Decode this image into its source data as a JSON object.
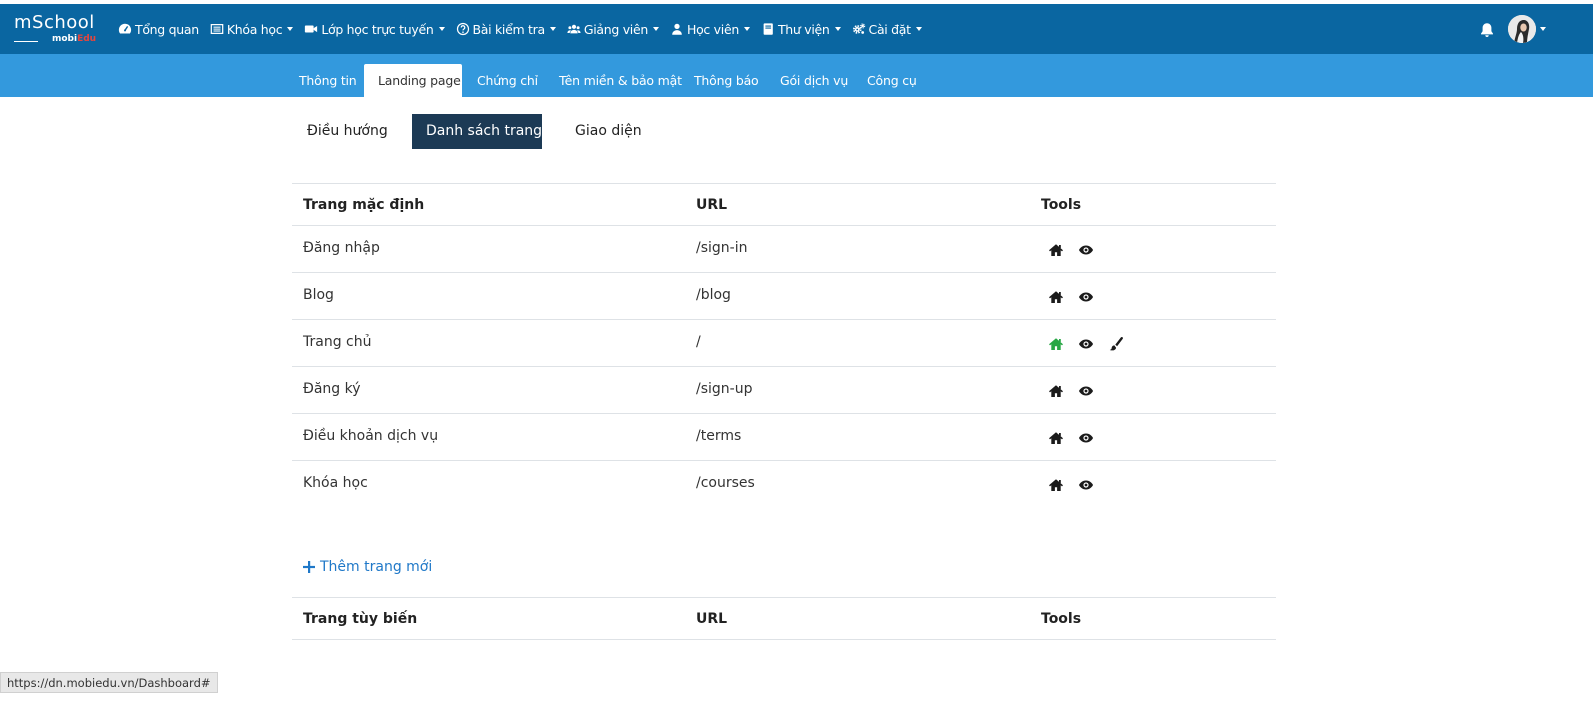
{
  "brand": {
    "logo_main": "mSchool",
    "logo_sub_a": "mobi",
    "logo_sub_b": "Edu"
  },
  "nav": [
    {
      "label": "Tổng quan",
      "icon": "dashboard-icon",
      "dropdown": false
    },
    {
      "label": "Khóa học",
      "icon": "list-icon",
      "dropdown": true
    },
    {
      "label": "Lớp học trực tuyến",
      "icon": "video-camera-icon",
      "dropdown": true
    },
    {
      "label": "Bài kiểm tra",
      "icon": "question-circle-icon",
      "dropdown": true
    },
    {
      "label": "Giảng viên",
      "icon": "users-icon",
      "dropdown": true
    },
    {
      "label": "Học viên",
      "icon": "user-icon",
      "dropdown": true
    },
    {
      "label": "Thư viện",
      "icon": "book-icon",
      "dropdown": true
    },
    {
      "label": "Cài đặt",
      "icon": "gears-icon",
      "dropdown": true
    }
  ],
  "subtabs": [
    {
      "label": "Thông tin"
    },
    {
      "label": "Landing page",
      "active": true
    },
    {
      "label": "Chứng chỉ"
    },
    {
      "label": "Tên miền & bảo mật"
    },
    {
      "label": "Thông báo"
    },
    {
      "label": "Gói dịch vụ"
    },
    {
      "label": "Công cụ"
    }
  ],
  "pills": [
    {
      "label": "Điều hướng"
    },
    {
      "label": "Danh sách trang",
      "active": true
    },
    {
      "label": "Giao diện"
    }
  ],
  "default_table": {
    "headers": {
      "name": "Trang mặc định",
      "url": "URL",
      "tools": "Tools"
    },
    "rows": [
      {
        "name": "Đăng nhập",
        "url": "/sign-in",
        "home_active": false,
        "editable": false
      },
      {
        "name": "Blog",
        "url": "/blog",
        "home_active": false,
        "editable": false
      },
      {
        "name": "Trang chủ",
        "url": "/",
        "home_active": true,
        "editable": true
      },
      {
        "name": "Đăng ký",
        "url": "/sign-up",
        "home_active": false,
        "editable": false
      },
      {
        "name": "Điều khoản dịch vụ",
        "url": "/terms",
        "home_active": false,
        "editable": false
      },
      {
        "name": "Khóa học",
        "url": "/courses",
        "home_active": false,
        "editable": false
      }
    ]
  },
  "add_page": {
    "label": "Thêm trang mới"
  },
  "custom_table": {
    "headers": {
      "name": "Trang tùy biến",
      "url": "URL",
      "tools": "Tools"
    }
  },
  "status_url": "https://dn.mobiedu.vn/Dashboard#",
  "colors": {
    "topbar": "#0a66a1",
    "subbar": "#3399dd",
    "pill_active": "#1c3a55",
    "home_active": "#28a745",
    "link": "#1f78c8"
  }
}
